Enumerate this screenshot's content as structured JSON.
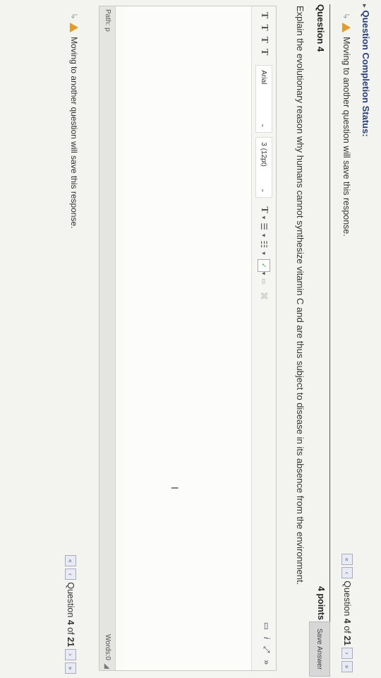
{
  "status": {
    "title": "Question Completion Status:"
  },
  "warning": {
    "text": "Moving to another question will save this response."
  },
  "nav": {
    "prefix": "Question ",
    "current": "4",
    "of_text": " of ",
    "total": "21"
  },
  "question": {
    "label": "Question 4",
    "points": "4 points",
    "save_label": "Save Answer",
    "text": "Explain the evolutionary reason why humans cannot synthesize vitamin C and are thus subject to disease in its absence from the environment."
  },
  "editor": {
    "font_family": "Arial",
    "font_size": "3 (12pt)",
    "path": "Path: p",
    "words": "Words:0"
  },
  "colors": {
    "link": "#27407a",
    "warning": "#e49b2a",
    "button": "#d7d7d7"
  },
  "icons": [
    "warning-icon",
    "double-left-icon",
    "left-icon",
    "right-icon",
    "double-right-icon",
    "spellcheck-icon",
    "fullscreen-icon",
    "collapse-icon"
  ]
}
